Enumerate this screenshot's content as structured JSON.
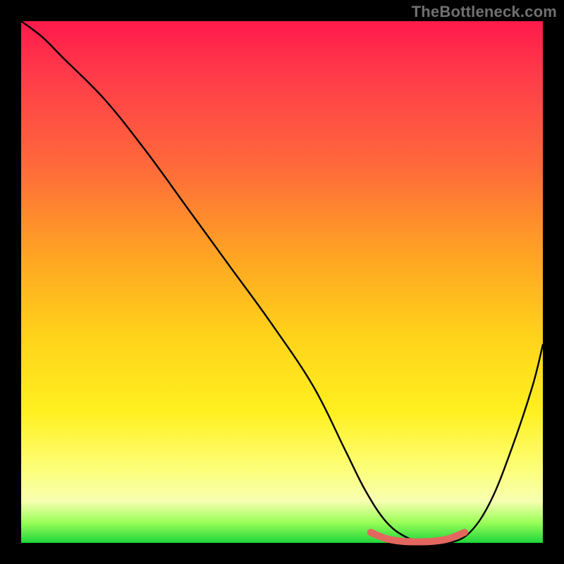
{
  "watermark": "TheBottleneck.com",
  "chart_data": {
    "type": "line",
    "title": "",
    "xlabel": "",
    "ylabel": "",
    "xlim": [
      0,
      100
    ],
    "ylim": [
      0,
      100
    ],
    "grid": false,
    "series": [
      {
        "name": "bottleneck-curve",
        "color": "#000000",
        "x": [
          0,
          4,
          8,
          16,
          24,
          32,
          40,
          48,
          56,
          62,
          66,
          70,
          74,
          78,
          82,
          86,
          90,
          94,
          98,
          100
        ],
        "y": [
          100,
          97,
          93,
          85,
          75,
          64,
          53,
          42,
          30,
          18,
          10,
          4,
          1,
          0,
          0,
          2,
          8,
          18,
          30,
          38
        ]
      },
      {
        "name": "sweet-spot-band",
        "color": "#e4675f",
        "x": [
          67,
          70,
          73,
          76,
          79,
          82,
          85
        ],
        "y": [
          2.0,
          0.8,
          0.3,
          0.2,
          0.3,
          0.8,
          2.0
        ]
      }
    ],
    "annotations": []
  }
}
